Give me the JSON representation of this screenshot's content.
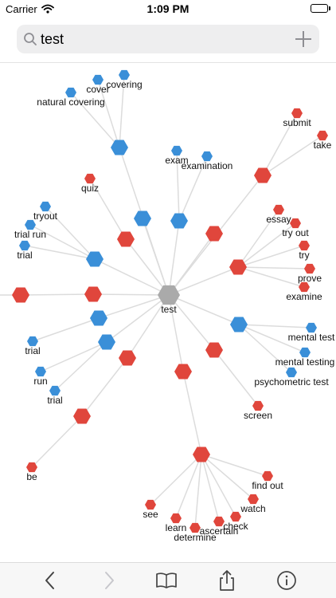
{
  "status_bar": {
    "carrier": "Carrier",
    "time": "1:09 PM",
    "icons": [
      "wifi-icon",
      "battery-icon"
    ]
  },
  "search": {
    "value": "test",
    "icons": [
      "search-icon",
      "plus-icon"
    ]
  },
  "colors": {
    "noun": "#3a8fd8",
    "verb": "#e0463c",
    "center": "#aaaaaa",
    "edge": "#dcdcdc"
  },
  "graph": {
    "center": "test",
    "labels": [
      "test",
      "cover",
      "covering",
      "natural covering",
      "submit",
      "take",
      "exam",
      "examination",
      "quiz",
      "tryout",
      "trial run",
      "trial",
      "essay",
      "try out",
      "try",
      "prove",
      "examine",
      "mental test",
      "trial",
      "mental testing",
      "run",
      "trial",
      "psychometric test",
      "screen",
      "be",
      "find out",
      "watch",
      "see",
      "check",
      "learn",
      "ascertain",
      "determine"
    ]
  },
  "toolbar": {
    "icons": [
      "back-icon",
      "forward-icon",
      "book-icon",
      "share-icon",
      "info-icon"
    ]
  }
}
